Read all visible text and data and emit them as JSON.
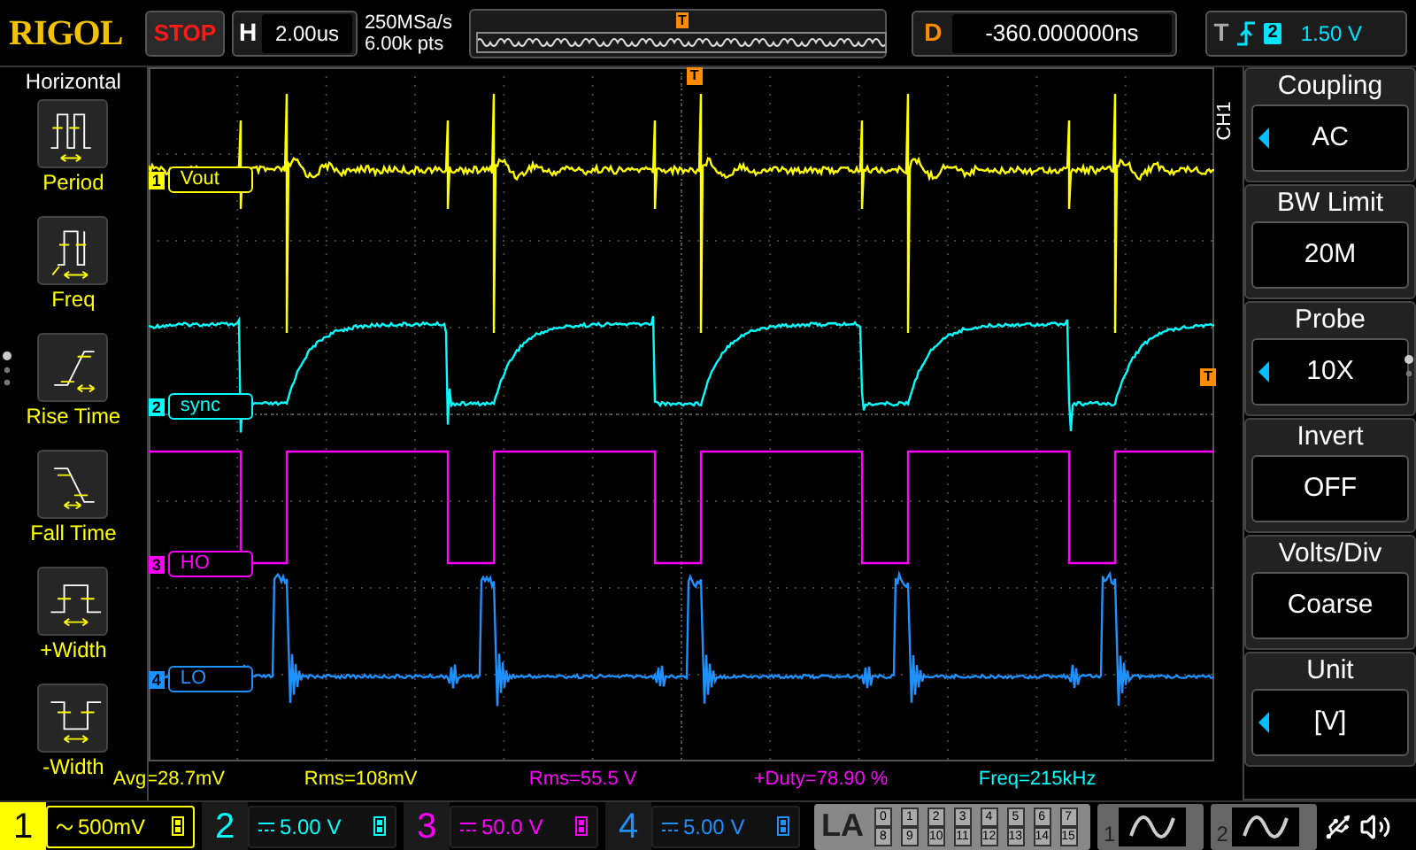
{
  "header": {
    "logo": "RIGOL",
    "run_state": "STOP",
    "timebase_label": "H",
    "timebase": "2.00us",
    "sample_rate": "250MSa/s",
    "memory_depth": "6.00k pts",
    "overview_marker": "T",
    "delay_label": "D",
    "delay": "-360.000000ns",
    "trigger_label": "T",
    "trigger_source": "2",
    "trigger_level": "1.50 V"
  },
  "measure_menu": {
    "title": "Horizontal",
    "items": [
      {
        "label": "Period",
        "kind": "period"
      },
      {
        "label": "Freq",
        "kind": "freq"
      },
      {
        "label": "Rise Time",
        "kind": "rise"
      },
      {
        "label": "Fall Time",
        "kind": "fall"
      },
      {
        "label": "+Width",
        "kind": "pwidth"
      },
      {
        "label": "-Width",
        "kind": "nwidth"
      }
    ]
  },
  "scope": {
    "trigger_position_marker": "T",
    "trigger_level_marker": "T",
    "traces": [
      {
        "number": "1",
        "name": "Vout",
        "color": "#ffff00",
        "kind": "vout"
      },
      {
        "number": "2",
        "name": "sync",
        "color": "#00ffff",
        "kind": "sync"
      },
      {
        "number": "3",
        "name": "HO",
        "color": "#ff00ff",
        "kind": "ho"
      },
      {
        "number": "4",
        "name": "LO",
        "color": "#1e90ff",
        "kind": "lo"
      }
    ]
  },
  "channel_menu": {
    "channel": "CH1",
    "items": [
      {
        "title": "Coupling",
        "value": "AC",
        "adjustable": true
      },
      {
        "title": "BW Limit",
        "value": "20M",
        "adjustable": false
      },
      {
        "title": "Probe",
        "value": "10X",
        "adjustable": true
      },
      {
        "title": "Invert",
        "value": "OFF",
        "adjustable": false
      },
      {
        "title": "Volts/Div",
        "value": "Coarse",
        "adjustable": false
      },
      {
        "title": "Unit",
        "value": "[V]",
        "adjustable": true
      }
    ]
  },
  "measurements": [
    {
      "text": "Avg=28.7mV",
      "color": "#ffff00"
    },
    {
      "text": "Rms=108mV",
      "color": "#ffff00"
    },
    {
      "text": "Rms=55.5 V",
      "color": "#ff00ff"
    },
    {
      "text": "+Duty=78.90 %",
      "color": "#ff00ff"
    },
    {
      "text": "Freq=215kHz",
      "color": "#00ffff"
    }
  ],
  "channels": [
    {
      "number": "1",
      "scale": "500mV",
      "kind": "ac",
      "selected": true,
      "color": "#ffff00"
    },
    {
      "number": "2",
      "scale": "5.00 V",
      "kind": "dc",
      "selected": false,
      "color": "#00ffff"
    },
    {
      "number": "3",
      "scale": "50.0 V",
      "kind": "dc",
      "selected": false,
      "color": "#ff00ff"
    },
    {
      "number": "4",
      "scale": "5.00 V",
      "kind": "dc",
      "selected": false,
      "color": "#1e90ff"
    }
  ],
  "logic_analyzer": {
    "label": "LA",
    "bits": [
      "0",
      "1",
      "2",
      "3",
      "4",
      "5",
      "6",
      "7",
      "8",
      "9",
      "10",
      "11",
      "12",
      "13",
      "14",
      "15"
    ]
  },
  "generators": [
    {
      "number": "1"
    },
    {
      "number": "2"
    }
  ]
}
